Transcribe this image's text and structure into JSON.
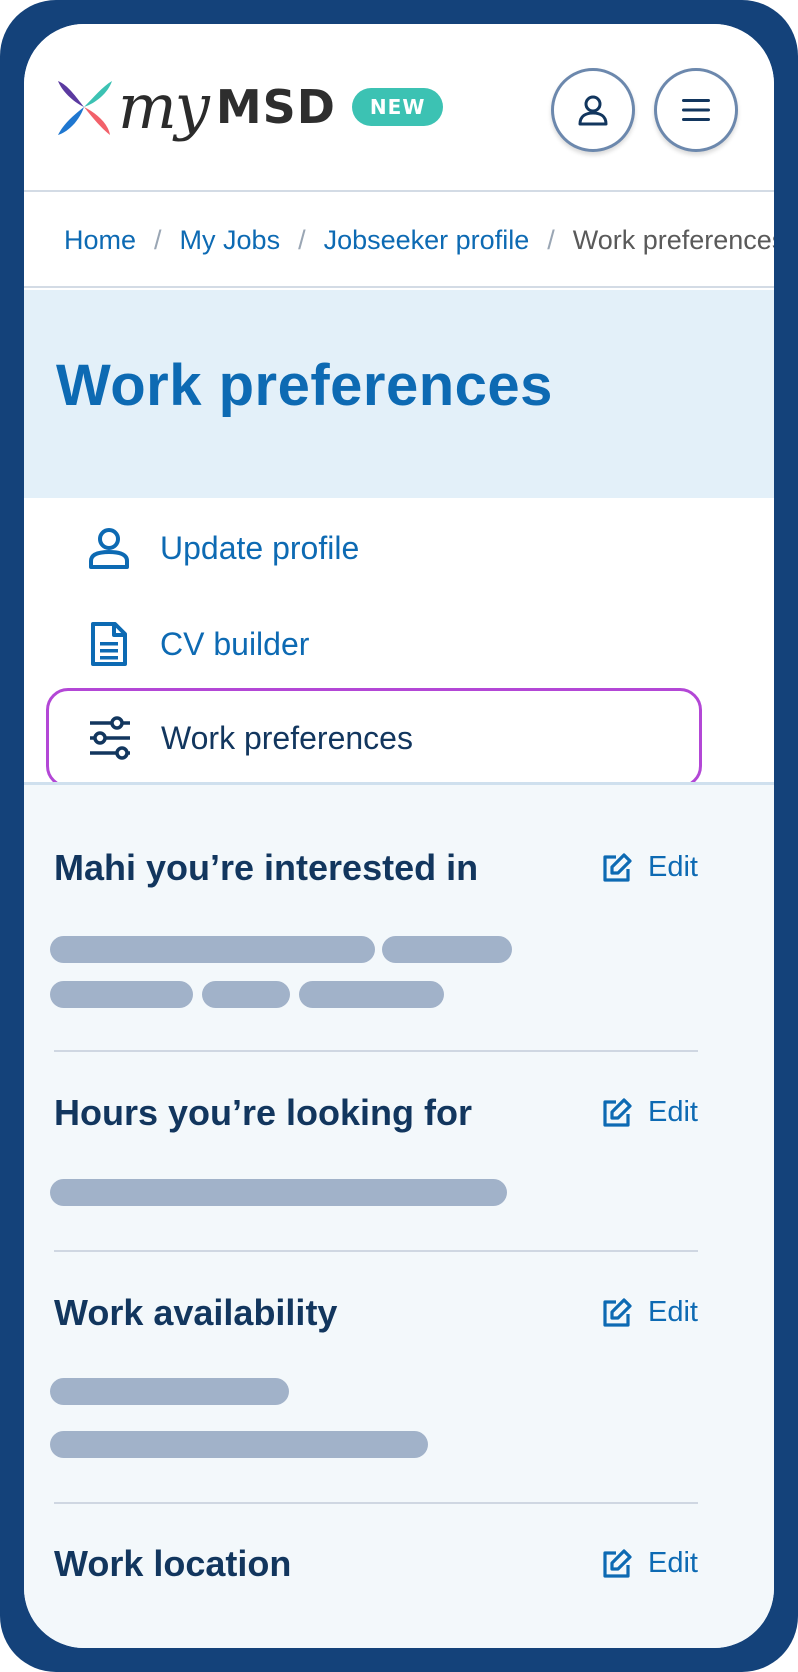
{
  "brand": {
    "logo_text_my": "my",
    "logo_text_msd": "MSD",
    "badge": "NEW"
  },
  "header": {
    "account_icon": "person-icon",
    "menu_icon": "hamburger-menu-icon"
  },
  "breadcrumb": {
    "items": [
      "Home",
      "My Jobs",
      "Jobseeker profile"
    ],
    "separator": "/",
    "current": "Work preferences"
  },
  "page": {
    "title": "Work preferences"
  },
  "subnav": {
    "items": [
      {
        "label": "Update profile",
        "icon": "person-icon"
      },
      {
        "label": "CV builder",
        "icon": "document-icon"
      },
      {
        "label": "Work preferences",
        "icon": "sliders-icon",
        "selected": true
      }
    ]
  },
  "sections": [
    {
      "title": "Mahi you’re interested in",
      "edit_label": "Edit"
    },
    {
      "title": "Hours you’re looking for",
      "edit_label": "Edit"
    },
    {
      "title": "Work availability",
      "edit_label": "Edit"
    },
    {
      "title": "Work location",
      "edit_label": "Edit"
    }
  ],
  "colors": {
    "frame": "#14427a",
    "primary_link": "#0d6ab3",
    "heading_dark": "#12365e",
    "banner_bg": "#e3f0f9",
    "badge_bg": "#3cc2b3",
    "focus_ring": "#b347d6",
    "skeleton": "#a1b2c9"
  }
}
